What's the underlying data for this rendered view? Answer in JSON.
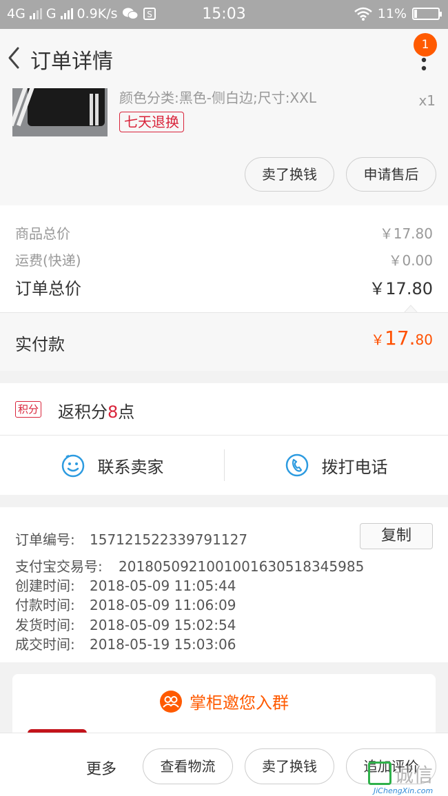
{
  "status_bar": {
    "network": "4G",
    "carrier": "G",
    "speed": "0.9K/s",
    "time": "15:03",
    "battery": "11%"
  },
  "header": {
    "title": "订单详情",
    "badge_count": "1"
  },
  "product": {
    "sku": "颜色分类:黑色-侧白边;尺寸:XXL",
    "quantity": "x1",
    "return_tag": "七天退换",
    "sell_button": "卖了换钱",
    "after_sale_button": "申请售后"
  },
  "price": {
    "goods_total_label": "商品总价",
    "goods_total_value": "￥17.80",
    "shipping_label": "运费(快递)",
    "shipping_value": "￥0.00",
    "order_total_label": "订单总价",
    "order_total_value": "￥17.80",
    "paid_label": "实付款",
    "paid_currency": "￥",
    "paid_integer": "17.",
    "paid_decimal": "80"
  },
  "points": {
    "tag": "积分",
    "prefix": "返积分",
    "value": "8",
    "suffix": "点"
  },
  "contact": {
    "seller_label": "联系卖家",
    "call_label": "拨打电话"
  },
  "order_info": {
    "order_no_label": "订单编号:",
    "order_no": "157121522339791127",
    "copy_button": "复制",
    "alipay_label": "支付宝交易号:",
    "alipay_no": "2018050921001001630518345985",
    "created_label": "创建时间:",
    "created": "2018-05-09 11:05:44",
    "paid_label": "付款时间:",
    "paid": "2018-05-09 11:06:09",
    "shipped_label": "发货时间:",
    "shipped": "2018-05-09 15:02:54",
    "closed_label": "成交时间:",
    "closed": "2018-05-19 15:03:06"
  },
  "group_card": {
    "title": "掌柜邀您入群"
  },
  "bottom_bar": {
    "more": "更多",
    "logistics_button": "查看物流",
    "sell_button": "卖了换钱",
    "review_button": "追加评价"
  },
  "watermark": {
    "text": "诚信",
    "sub": "JiChengXin.com"
  },
  "colors": {
    "accent_orange": "#ff5000",
    "tag_red": "#d9233a",
    "icon_blue": "#2d9be0",
    "status_bar_gray": "#a8a8a8"
  }
}
